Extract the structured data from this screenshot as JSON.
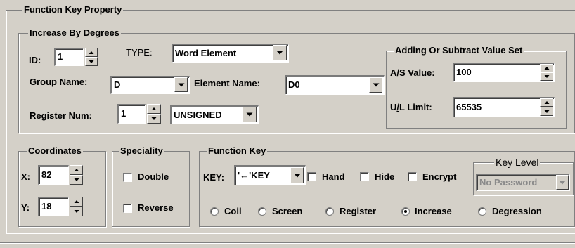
{
  "panel": {
    "title": "Function Key Property"
  },
  "increase": {
    "title": "Increase By Degrees",
    "id_label": "ID:",
    "id_value": "1",
    "type_label": "TYPE:",
    "type_value": "Word Element",
    "group_label": "Group Name:",
    "group_value": "D",
    "element_label": "Element Name:",
    "element_value": "D0",
    "register_label": "Register Num:",
    "register_value": "1",
    "sign_value": "UNSIGNED"
  },
  "adding": {
    "title": "Adding Or Subtract Value Set",
    "as_label_pre": "A",
    "as_label_u": "/",
    "as_label_post": "S Value:",
    "as_value": "100",
    "ul_label_pre": "U",
    "ul_label_u": "/",
    "ul_label_post": "L Limit:",
    "ul_value": "65535"
  },
  "coordinates": {
    "title": "Coordinates",
    "x_label": "X:",
    "x_value": "82",
    "y_label": "Y:",
    "y_value": "18"
  },
  "speciality": {
    "title": "Speciality",
    "double_label": "Double",
    "double_checked": false,
    "reverse_label": "Reverse",
    "reverse_checked": false
  },
  "function_key": {
    "title": "Function Key",
    "key_label": "KEY:",
    "key_value": "'←'KEY",
    "hand_label": "Hand",
    "hide_label": "Hide",
    "encrypt_label": "Encrypt",
    "key_level_title": "Key Level",
    "key_level_value": "No Password",
    "radios": [
      {
        "label": "Coil",
        "selected": false
      },
      {
        "label": "Screen",
        "selected": false
      },
      {
        "label": "Register",
        "selected": false
      },
      {
        "label": "Increase",
        "selected": true
      },
      {
        "label": "Degression",
        "selected": false
      }
    ]
  },
  "icons": {
    "spin_up": "spin-up-arrow-icon",
    "spin_down": "spin-down-arrow-icon",
    "dropdown": "dropdown-arrow-icon"
  }
}
